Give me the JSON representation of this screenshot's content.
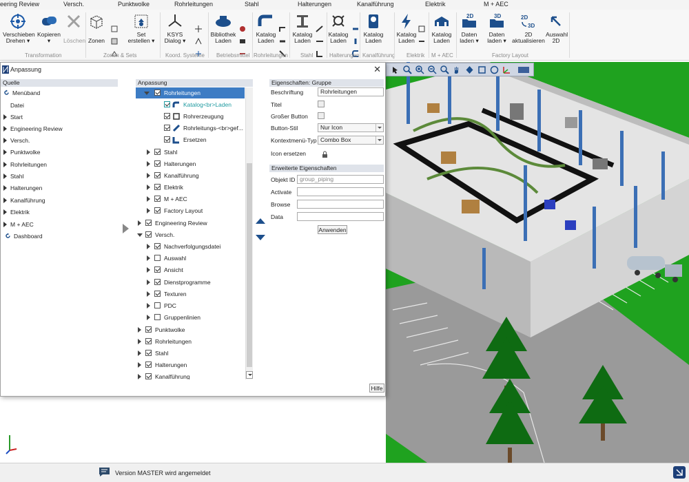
{
  "ribbon_tabs": [
    "eering Review",
    "Versch.",
    "Punktwolke",
    "Rohrleitungen",
    "Stahl",
    "Halterungen",
    "Kanalführung",
    "Elektrik",
    "M + AEC"
  ],
  "ribbon": {
    "buttons": [
      {
        "label1": "Verschieben",
        "label2": "Drehen ▾"
      },
      {
        "label1": "Kopieren",
        "label2": "▾"
      },
      {
        "label1": "",
        "label2": "Löschen"
      },
      {
        "label1": "",
        "label2": "Zonen"
      },
      {
        "label1": "Set",
        "label2": "erstellen ▾"
      },
      {
        "label1": "KSYS",
        "label2": "Dialog ▾"
      },
      {
        "label1": "Bibliothek",
        "label2": "Laden"
      },
      {
        "label1": "Katalog",
        "label2": "Laden"
      },
      {
        "label1": "Katalog",
        "label2": "Laden"
      },
      {
        "label1": "Katalog",
        "label2": "Laden"
      },
      {
        "label1": "Katalog",
        "label2": "Laden"
      },
      {
        "label1": "Katalog",
        "label2": "Laden"
      },
      {
        "label1": "Katalog",
        "label2": "Laden"
      },
      {
        "label1": "Daten",
        "label2": "laden ▾"
      },
      {
        "label1": "Daten",
        "label2": "laden ▾"
      },
      {
        "label1": "2D",
        "label2": "aktualisieren"
      },
      {
        "label1": "Auswahl",
        "label2": "2D"
      }
    ],
    "groups": [
      "Transformation",
      "Zonen & Sets",
      "Koord. Systeme",
      "Betriebsmittel",
      "Rohrleitungen",
      "Stahl",
      "Halterungen",
      "Kanalführung",
      "Elektrik",
      "M + AEC",
      "Factory Layout"
    ],
    "icon_texts": {
      "d2": "2D",
      "d3": "3D",
      "d23a": "2D",
      "d23b": "3D"
    }
  },
  "dialog": {
    "title": "Anpassung",
    "close": "✕",
    "source": {
      "header": "Quelle",
      "items": [
        "Menüband",
        "Datei",
        "Start",
        "Engineering Review",
        "Versch.",
        "Punktwolke",
        "Rohrleitungen",
        "Stahl",
        "Halterungen",
        "Kanalführung",
        "Elektrik",
        "M + AEC",
        "Dashboard"
      ]
    },
    "custom": {
      "header": "Anpassung",
      "rows": [
        {
          "label": "Rohrleitungen"
        },
        {
          "label": "Katalog<br>Laden"
        },
        {
          "label": "Rohrerzeugung"
        },
        {
          "label": "Rohrleitungs-<br>gef..."
        },
        {
          "label": "Ersetzen"
        },
        {
          "label": "Stahl"
        },
        {
          "label": "Halterungen"
        },
        {
          "label": "Kanalführung"
        },
        {
          "label": "Elektrik"
        },
        {
          "label": "M + AEC"
        },
        {
          "label": "Factory Layout"
        },
        {
          "label": "Engineering Review"
        },
        {
          "label": "Versch."
        },
        {
          "label": "Nachverfolgungsdatei"
        },
        {
          "label": "Auswahl"
        },
        {
          "label": "Ansicht"
        },
        {
          "label": "Dienstprogramme"
        },
        {
          "label": "Texturen"
        },
        {
          "label": "PDC"
        },
        {
          "label": "Gruppenlinien"
        },
        {
          "label": "Punktwolke"
        },
        {
          "label": "Rohrleitungen"
        },
        {
          "label": "Stahl"
        },
        {
          "label": "Halterungen"
        },
        {
          "label": "Kanalführung"
        }
      ]
    },
    "props": {
      "header": "Eigenschaften: Gruppe",
      "beschriftung_label": "Beschriftung",
      "beschriftung_value": "Rohrleitungen",
      "titel_label": "Titel",
      "grosser_label": "Großer Button",
      "stil_label": "Button-Stil",
      "stil_value": "Nur Icon",
      "kontext_label": "Kontextmenü-Typ",
      "kontext_value": "Combo Box",
      "icon_label": "Icon ersetzen",
      "ext_header": "Erweiterte Eigenschaften",
      "objekt_label": "Objekt ID",
      "objekt_value": "group_piping",
      "activate_label": "Activate",
      "browse_label": "Browse",
      "data_label": "Data",
      "apply": "Anwenden"
    },
    "help": "Hilfe"
  },
  "status": {
    "message": "Version MASTER wird angemeldet"
  }
}
